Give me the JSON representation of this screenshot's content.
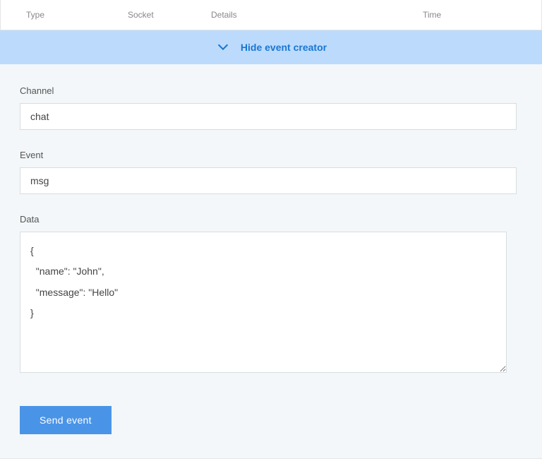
{
  "table_header": {
    "type": "Type",
    "socket": "Socket",
    "details": "Details",
    "time": "Time"
  },
  "banner": {
    "label": "Hide event creator"
  },
  "form": {
    "channel": {
      "label": "Channel",
      "value": "chat"
    },
    "event": {
      "label": "Event",
      "value": "msg"
    },
    "data": {
      "label": "Data",
      "value": "{\n  \"name\": \"John\",\n  \"message\": \"Hello\"\n}"
    },
    "submit_label": "Send event"
  }
}
